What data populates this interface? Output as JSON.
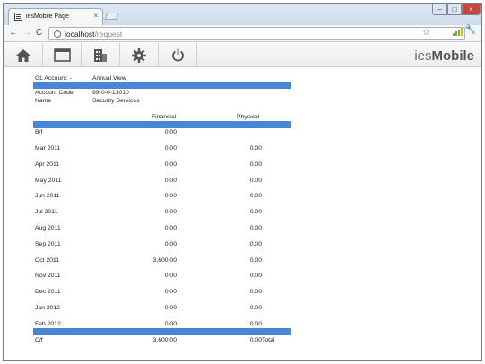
{
  "browser": {
    "tab_title": "iesMobile Page",
    "tab_close": "×",
    "url_host": "localhost",
    "url_path": "/request",
    "back": "←",
    "forward": "→",
    "reload": "C",
    "star": "☆",
    "wrench": "🔧",
    "minimize": "–",
    "maximize": "□",
    "close": "×"
  },
  "appbar": {
    "brand_prefix": "ies",
    "brand_suffix": "Mobile",
    "buttons": [
      "home-icon",
      "window-icon",
      "building-icon",
      "gear-icon",
      "power-icon"
    ]
  },
  "report": {
    "gl_account_label": "GL Account: -",
    "view_label": "Annual View",
    "account_code_label": "Account Code",
    "account_code_value": "99-0-0-13010",
    "name_label": "Name",
    "name_value": "Security Services",
    "col_financial": "Financial",
    "col_physical": "Physical",
    "bf": {
      "label": "B/f",
      "financial": "0.00",
      "physical": ""
    },
    "rows": [
      {
        "label": "Mar 2011",
        "financial": "0.00",
        "physical": "0.00"
      },
      {
        "label": "Apr 2011",
        "financial": "0.00",
        "physical": "0.00"
      },
      {
        "label": "May 2011",
        "financial": "0.00",
        "physical": "0.00"
      },
      {
        "label": "Jun 2011",
        "financial": "0.00",
        "physical": "0.00"
      },
      {
        "label": "Jul 2011",
        "financial": "0.00",
        "physical": "0.00"
      },
      {
        "label": "Aug 2011",
        "financial": "0.00",
        "physical": "0.00"
      },
      {
        "label": "Sep 2011",
        "financial": "0.00",
        "physical": "0.00"
      },
      {
        "label": "Oct 2011",
        "financial": "3,600.00",
        "physical": "0.00"
      },
      {
        "label": "Nov 2011",
        "financial": "0.00",
        "physical": "0.00"
      },
      {
        "label": "Dec 2011",
        "financial": "0.00",
        "physical": "0.00"
      },
      {
        "label": "Jan 2012",
        "financial": "0.00",
        "physical": "0.00"
      },
      {
        "label": "Feb 2012",
        "financial": "0.00",
        "physical": "0.00"
      }
    ],
    "cf": {
      "label": "C/f",
      "financial": "3,600.00",
      "physical": "0.00",
      "total_label": "Total"
    }
  },
  "colors": {
    "accent_bar": "#4a86d6",
    "close_button": "#c9443b"
  }
}
